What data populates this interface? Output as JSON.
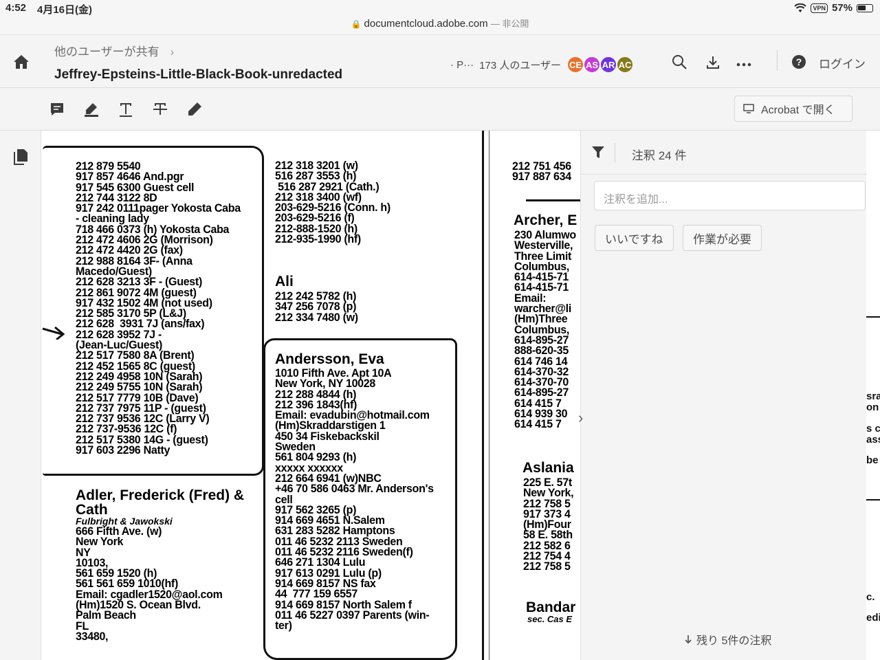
{
  "status_bar": {
    "time": "4:52",
    "date": "4月16日(金)",
    "vpn": "VPN",
    "battery": "57%"
  },
  "browser": {
    "url": "documentcloud.adobe.com",
    "private_label": "— 非公開"
  },
  "header": {
    "breadcrumb": "他のユーザーが共有",
    "title": "Jeffrey-Epsteins-Little-Black-Book-unredacted",
    "partial_label": "· P···",
    "users_label": "173 人のユーザー",
    "avatars": [
      {
        "initials": "CE",
        "color": "#e8712d"
      },
      {
        "initials": "AS",
        "color": "#c33dd1"
      },
      {
        "initials": "AR",
        "color": "#6e35d8"
      },
      {
        "initials": "AC",
        "color": "#857a1a"
      }
    ],
    "login": "ログイン",
    "icons": [
      "home-icon",
      "search-icon",
      "download-icon",
      "more-icon",
      "help-icon"
    ]
  },
  "toolbar": {
    "tools": [
      "comment-icon",
      "highlight-icon",
      "text-icon",
      "strikethrough-icon",
      "draw-icon"
    ],
    "open_in_acrobat": "Acrobat で開く"
  },
  "document": {
    "col1_top": "212 879 5540\n917 857 4646 And.pgr\n917 545 6300 Guest cell\n212 744 3122 8D\n917 242 0111pager Yokosta Caba\n- cleaning lady\n718 466 0373 (h) Yokosta Caba\n212 472 4606 2G (Morrison)\n212 472 4420 2G (fax)\n212 988 8164 3F- (Anna\nMacedo/Guest)\n212 628 3213 3F - (Guest)\n212 861 9072 4M (guest)\n917 432 1502 4M (not used)\n212 585 3170 5P (L&J)\n212 628  3931 7J (ans/fax)\n212 628 3952 7J -\n(Jean-Luc/Guest)\n212 517 7580 8A (Brent)\n212 452 1565 8C (guest)\n212 249 4958 10N (Sarah)\n212 249 5755 10N (Sarah)\n212 517 7779 10B (Dave)\n212 737 7975 11P - (guest)\n212 737 9536 12C (Larry V)\n212 737-9536 12C (f)\n212 517 5380 14G - (guest)\n917 603 2296 Natty",
    "adler_name": "Adler, Frederick (Fred) &\nCath",
    "adler_sub": "Fulbright & Jawokski",
    "adler_lines": "666 Fifth Ave. (w)\nNew York\nNY\n10103,\n561 659 1520 (h)\n561 561 659 1010(hf)\nEmail: cgadler1520@aol.com\n(Hm)1520 S. Ocean Blvd.\nPalm Beach\nFL\n33480,",
    "col2_top": "212 318 3201 (w)\n516 287 3553 (h)\n 516 287 2921 (Cath.)\n212 318 3400 (wf)\n203-629-5216 (Conn. h)\n203-629-5216 (f)\n212-888-1520 (h)\n212-935-1990 (hf)",
    "ali_name": "Ali",
    "ali_lines": "212 242 5782 (h)\n347 256 7078 (p)\n212 334 7480 (w)",
    "andersson_name": "Andersson, Eva",
    "andersson_lines": "1010 Fifth Ave. Apt 10A\nNew York, NY 10028\n212 288 4844 (h)\n212 396 1843(hf)\nEmail: evadubin@hotmail.com\n(Hm)Skraddarstigen 1\n450 34 Fiskebackskil\nSweden\n561 804 9293 (h)\nxxxxx xxxxxx\n212 664 6941 (w)NBC\n+46 70 586 0463 Mr. Anderson's\ncell\n917 562 3265 (p)\n914 669 4651 N.Salem\n631 283 5282 Hamptons\n011 46 5232 2113 Sweden\n011 46 5232 2116 Sweden(f)\n646 271 1304 Lulu\n917 613 0291 Lulu (p)\n914 669 8157 NS fax\n44  777 159 6557\n914 669 8157 North Salem f\n011 46 5227 0397 Parents (win-\nter)",
    "col3_top": "212 751 456\n917 887 634",
    "archer_name": "Archer, E",
    "archer_lines": "230 Alumwo\nWesterville,\nThree Limit\nColumbus,\n614-415-71\n614-415-71\nEmail:\nwarcher@li\n(Hm)Three\nColumbus,\n614-895-27\n888-620-35\n614 746 14\n614-370-32\n614-370-70\n614-895-27\n614 415 7\n614 939 30\n614 415 7",
    "aslania_name": "Aslania",
    "aslania_lines": "225 E. 57t\nNew York,\n212 758 5\n917 373 4\n(Hm)Four\n58 E. 58th\n212 582 6\n212 754 4\n212 758 5",
    "bandar_name": "Bandar",
    "bandar_sub": "sec. Cas E",
    "right_edge": [
      "sra",
      "on",
      "s c",
      "ass",
      "be",
      "c.",
      "edi"
    ]
  },
  "comments": {
    "count_label": "注釈 24 件",
    "input_placeholder": "注釈を追加...",
    "like": "いいですね",
    "needs_work": "作業が必要",
    "more": "残り 5件の注釈"
  }
}
